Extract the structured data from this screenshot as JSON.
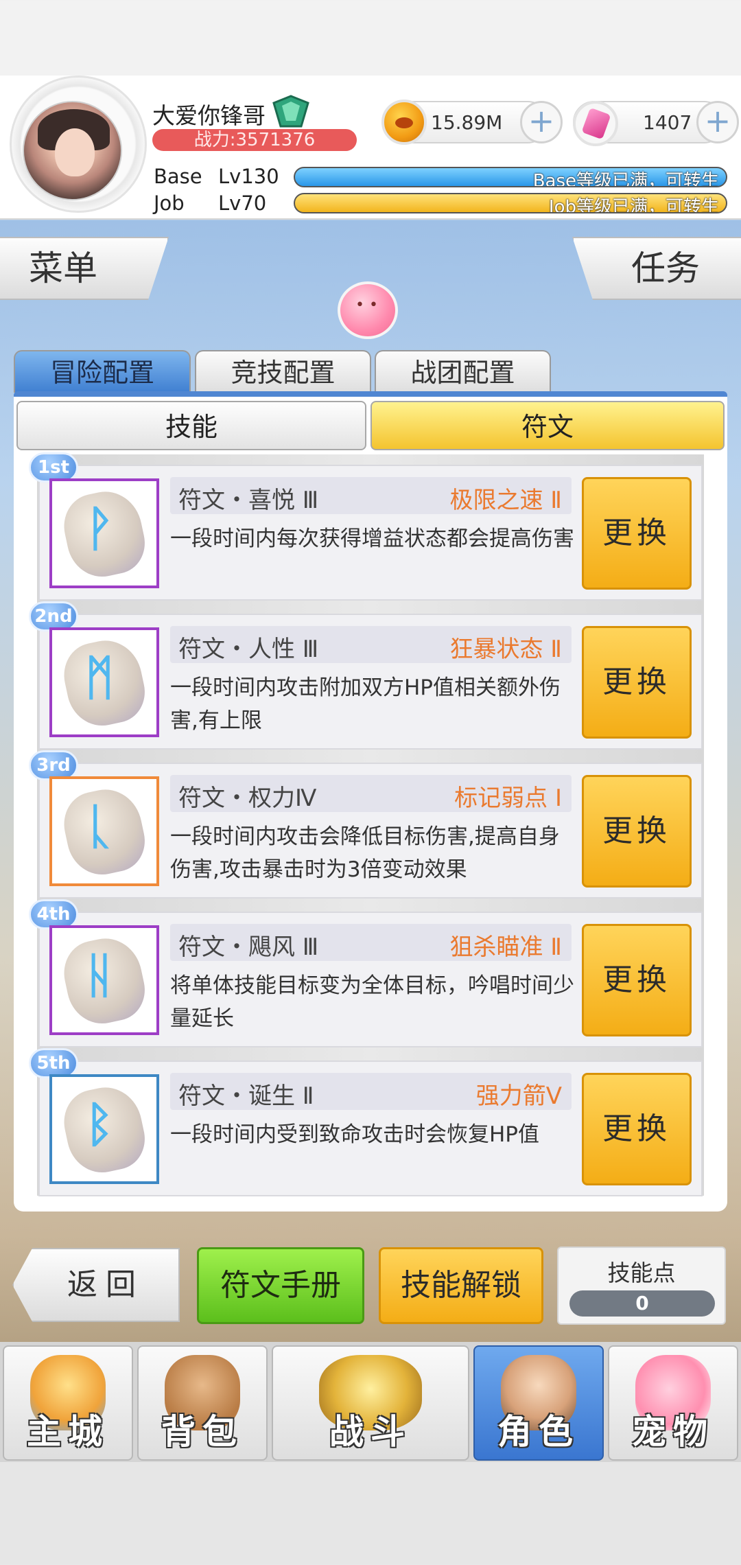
{
  "player": {
    "name": "大爱你锋哥",
    "power": "战力:3571376",
    "base_label": "Base",
    "base_level": "Lv130",
    "base_status": "Base等级已满，可转生",
    "job_label": "Job",
    "job_level": "Lv70",
    "job_status": "Job等级已满，可转生"
  },
  "currency": {
    "gold": "15.89M",
    "gems": "1407"
  },
  "side": {
    "menu": "菜单",
    "task": "任务"
  },
  "tabs": [
    "冒险配置",
    "竞技配置",
    "战团配置"
  ],
  "active_tab": 0,
  "subtabs": {
    "skill": "技能",
    "rune": "符文"
  },
  "runes": [
    {
      "rank": "1st",
      "name": "符文・喜悦 Ⅲ",
      "tag": "极限之速 Ⅱ",
      "desc": "一段时间内每次获得增益状态都会提高伤害",
      "frame": "purple",
      "glyph": "ᚹ",
      "button": "更换"
    },
    {
      "rank": "2nd",
      "name": "符文・人性 Ⅲ",
      "tag": "狂暴状态 Ⅱ",
      "desc": "一段时间内攻击附加双方HP值相关额外伤害,有上限",
      "frame": "purple",
      "glyph": "ᛗ",
      "button": "更换"
    },
    {
      "rank": "3rd",
      "name": "符文・权力Ⅳ",
      "tag": "标记弱点 Ⅰ",
      "desc": "一段时间内攻击会降低目标伤害,提高自身伤害,攻击暴击时为3倍变动效果",
      "frame": "orange",
      "glyph": "ᚳ",
      "button": "更换"
    },
    {
      "rank": "4th",
      "name": "符文・飓风 Ⅲ",
      "tag": "狙杀瞄准 Ⅱ",
      "desc": "将单体技能目标变为全体目标，吟唱时间少量延长",
      "frame": "purple",
      "glyph": "ᚺ",
      "button": "更换"
    },
    {
      "rank": "5th",
      "name": "符文・诞生 Ⅱ",
      "tag": "强力箭Ⅴ",
      "desc": "一段时间内受到致命攻击时会恢复HP值",
      "frame": "blue",
      "glyph": "ᛒ",
      "button": "更换"
    }
  ],
  "actions": {
    "back": "返回",
    "rune_book": "符文手册",
    "skill_unlock": "技能解锁",
    "skill_points_label": "技能点",
    "skill_points": "0"
  },
  "nav": [
    {
      "label": "主城",
      "icon": "castle-icon"
    },
    {
      "label": "背包",
      "icon": "backpack-icon"
    },
    {
      "label": "战斗",
      "icon": "battle-icon"
    },
    {
      "label": "角色",
      "icon": "character-icon"
    },
    {
      "label": "宠物",
      "icon": "pet-icon"
    }
  ],
  "active_nav": 3,
  "colors": {
    "accent_blue": "#4f86d2",
    "button_gold": "#f4ad16",
    "button_green": "#5cbf1c",
    "tag_orange": "#ea7a2f",
    "power_red": "#e85a5a"
  }
}
